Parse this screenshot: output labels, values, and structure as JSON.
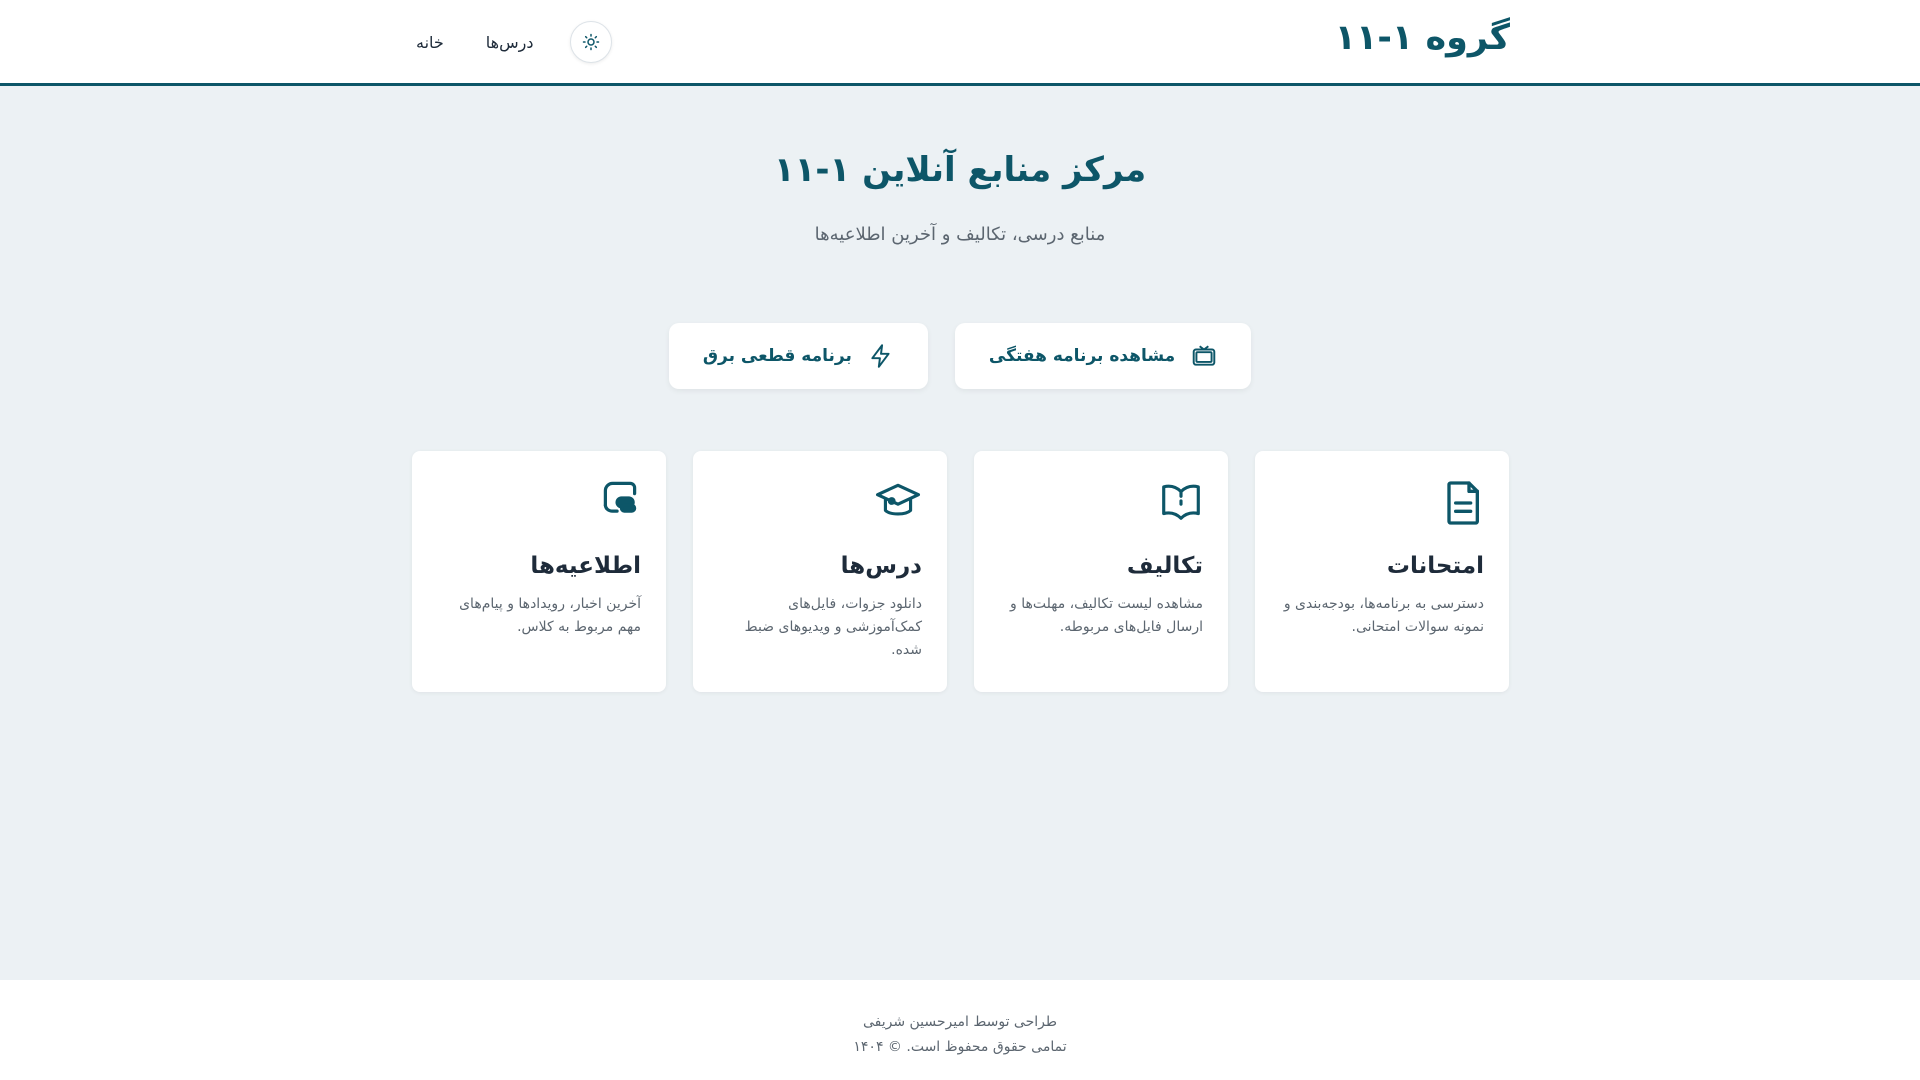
{
  "header": {
    "brand": "گروه ۱-۱۱",
    "nav": {
      "home": "خانه",
      "lessons": "درس‌ها"
    },
    "theme_icon": "sun-icon"
  },
  "hero": {
    "title": "مرکز منابع آنلاین ۱-۱۱",
    "subtitle": "منابع درسی، تکالیف و آخرین اطلاعیه‌ها"
  },
  "actions": {
    "weekly_schedule": {
      "label": "مشاهده برنامه هفتگی",
      "icon": "tv-icon"
    },
    "power_outage": {
      "label": "برنامه قطعی برق",
      "icon": "lightning-icon"
    }
  },
  "cards": [
    {
      "title": "امتحانات",
      "desc": "دسترسی به برنامه‌ها، بودجه‌بندی و نمونه سوالات امتحانی.",
      "icon": "document-icon"
    },
    {
      "title": "تکالیف",
      "desc": "مشاهده لیست تکالیف، مهلت‌ها و ارسال فایل‌های مربوطه.",
      "icon": "open-book-icon"
    },
    {
      "title": "درس‌ها",
      "desc": "دانلود جزوات، فایل‌های کمک‌آموزشی و ویدیوهای ضبط شده.",
      "icon": "graduation-cap-icon"
    },
    {
      "title": "اطلاعیه‌ها",
      "desc": "آخرین اخبار، رویدادها و پیام‌های مهم مربوط به کلاس.",
      "icon": "megaphone-icon"
    }
  ],
  "footer": {
    "credit": "طراحی توسط امیرحسین شریفی",
    "copyright": "تمامی حقوق محفوظ است. © ۱۴۰۴"
  },
  "colors": {
    "primary": "#0d5668",
    "background": "#ecf1f4",
    "text": "#1e2b3a",
    "muted": "#5c6670"
  }
}
